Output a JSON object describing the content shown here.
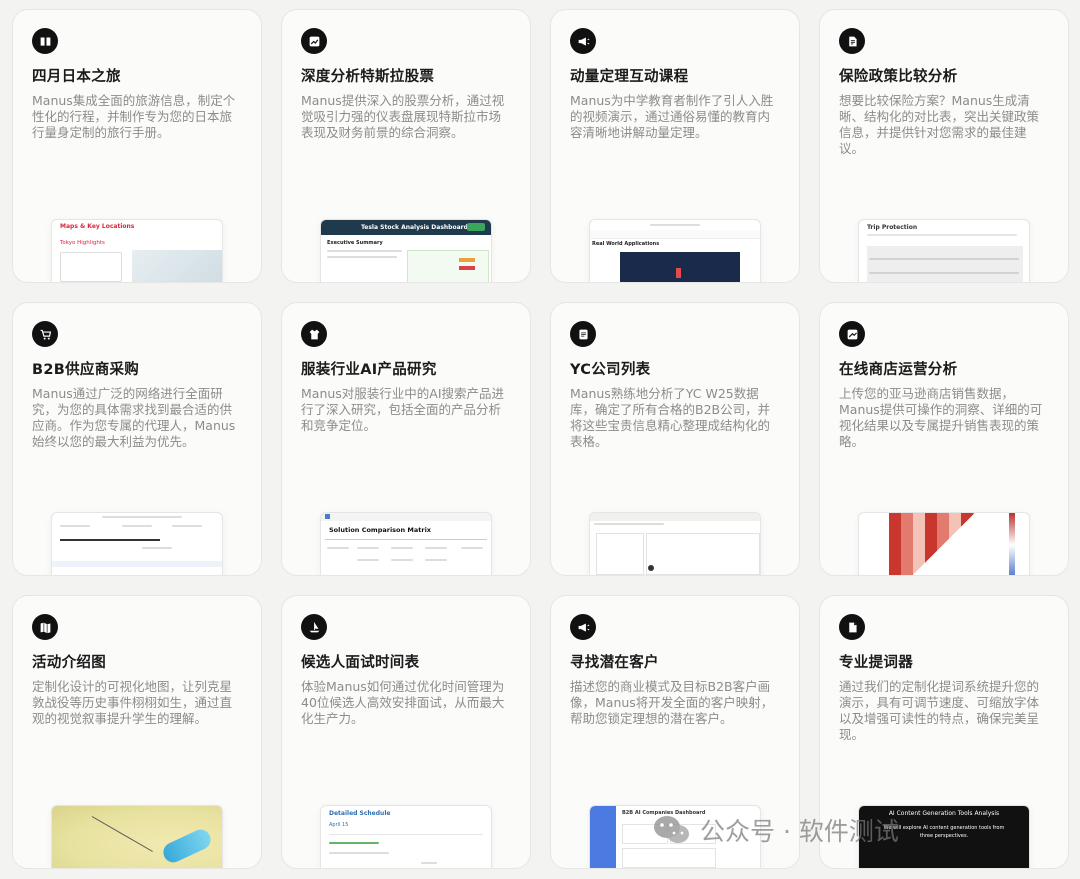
{
  "cards": [
    {
      "icon": "book-icon",
      "title": "四月日本之旅",
      "desc": "Manus集成全面的旅游信息，制定个性化的行程，并制作专为您的日本旅行量身定制的旅行手册。",
      "preview": {
        "title": "Maps & Key Locations",
        "subtitle": "Tokyo Highlights",
        "accent": "#d7263d"
      }
    },
    {
      "icon": "chart-icon",
      "title": "深度分析特斯拉股票",
      "desc": "Manus提供深入的股票分析，通过视觉吸引力强的仪表盘展现特斯拉市场表现及财务前景的综合洞察。",
      "preview": {
        "title": "Tesla Stock Analysis Dashboard",
        "subtitle": "Executive Summary",
        "accent": "#1f3a4d"
      }
    },
    {
      "icon": "megaphone-icon",
      "title": "动量定理互动课程",
      "desc": "Manus为中学教育者制作了引人入胜的视频演示，通过通俗易懂的教育内容清晰地讲解动量定理。",
      "preview": {
        "title": "",
        "subtitle": "Real World Applications",
        "accent": "#1a2a4a"
      }
    },
    {
      "icon": "document-icon",
      "title": "保险政策比较分析",
      "desc": "想要比较保险方案？Manus生成清晰、结构化的对比表，突出关键政策信息，并提供针对您需求的最佳建议。",
      "preview": {
        "title": "Trip Protection",
        "subtitle": "",
        "accent": "#eeeeee"
      }
    },
    {
      "icon": "cart-icon",
      "title": "B2B供应商采购",
      "desc": "Manus通过广泛的网络进行全面研究，为您的具体需求找到最合适的供应商。作为您专属的代理人，Manus始终以您的最大利益为优先。",
      "preview": {
        "title": "",
        "subtitle": "",
        "accent": "#dddddd"
      }
    },
    {
      "icon": "shirt-icon",
      "title": "服装行业AI产品研究",
      "desc": "Manus对服装行业中的AI搜索产品进行了深入研究，包括全面的产品分析和竞争定位。",
      "preview": {
        "title": "Solution Comparison Matrix",
        "subtitle": "",
        "accent": "#4a7bd0"
      }
    },
    {
      "icon": "list-icon",
      "title": "YC公司列表",
      "desc": "Manus熟练地分析了YC W25数据库，确定了所有合格的B2B公司，并将这些宝贵信息精心整理成结构化的表格。",
      "preview": {
        "title": "",
        "subtitle": "",
        "accent": "#f0f0ec"
      }
    },
    {
      "icon": "trend-icon",
      "title": "在线商店运营分析",
      "desc": "上传您的亚马逊商店销售数据，Manus提供可操作的洞察、详细的可视化结果以及专属提升销售表现的策略。",
      "preview": {
        "title": "",
        "subtitle": "",
        "accent": "#c9362e"
      }
    },
    {
      "icon": "map-icon",
      "title": "活动介绍图",
      "desc": "定制化设计的可视化地图，让列克星敦战役等历史事件栩栩如生，通过直观的视觉叙事提升学生的理解。",
      "preview": {
        "title": "",
        "subtitle": "",
        "accent": "#e8e2a0"
      }
    },
    {
      "icon": "ship-icon",
      "title": "候选人面试时间表",
      "desc": "体验Manus如何通过优化时间管理为40位候选人高效安排面试，从而最大化生产力。",
      "preview": {
        "title": "Detailed Schedule",
        "subtitle": "April 15",
        "accent": "#2f6db3"
      }
    },
    {
      "icon": "megaphone-icon",
      "title": "寻找潜在客户",
      "desc": "描述您的商业模式及目标B2B客户画像，Manus将开发全面的客户映射，帮助您锁定理想的潜在客户。",
      "preview": {
        "title": "B2B AI Companies Dashboard",
        "subtitle": "",
        "accent": "#4b7be0"
      }
    },
    {
      "icon": "file-icon",
      "title": "专业提词器",
      "desc": "通过我们的定制化提词系统提升您的演示，具有可调节速度、可缩放字体以及增强可读性的特点，确保完美呈现。",
      "preview": {
        "title": "AI Content Generation Tools Analysis",
        "subtitle": "We will explore AI content generation tools from three perspectives.",
        "accent": "#111111"
      }
    }
  ],
  "watermark": {
    "text": "公众号 · 软件测试"
  }
}
